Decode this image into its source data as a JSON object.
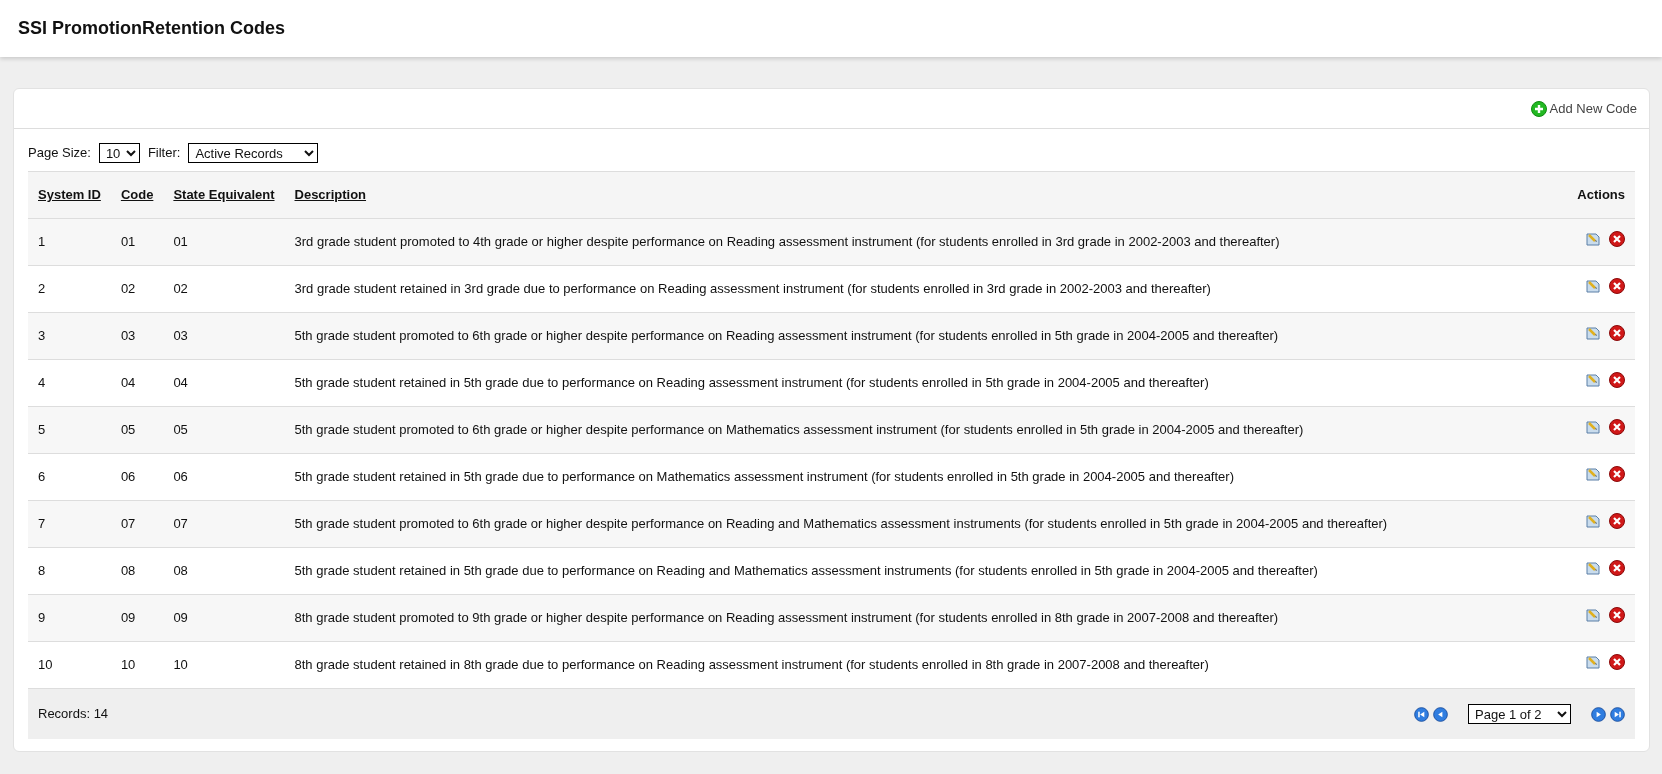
{
  "page_title": "SSI PromotionRetention Codes",
  "add_button": "Add New Code",
  "page_size": {
    "label": "Page Size:",
    "value": "10"
  },
  "filter": {
    "label": "Filter:",
    "value": "Active Records"
  },
  "table": {
    "columns": [
      "System ID",
      "Code",
      "State Equivalent",
      "Description",
      "Actions"
    ],
    "rows": [
      {
        "system_id": "1",
        "code": "01",
        "state_equivalent": "01",
        "description": "3rd grade student promoted to 4th grade or higher despite performance on Reading assessment instrument (for students enrolled in 3rd grade in 2002-2003 and thereafter)"
      },
      {
        "system_id": "2",
        "code": "02",
        "state_equivalent": "02",
        "description": "3rd grade student retained in 3rd grade due to performance on Reading assessment instrument (for students enrolled in 3rd grade in 2002-2003 and thereafter)"
      },
      {
        "system_id": "3",
        "code": "03",
        "state_equivalent": "03",
        "description": "5th grade student promoted to 6th grade or higher despite performance on Reading assessment instrument (for students enrolled in 5th grade in 2004-2005 and thereafter)"
      },
      {
        "system_id": "4",
        "code": "04",
        "state_equivalent": "04",
        "description": "5th grade student retained in 5th grade due to performance on Reading assessment instrument (for students enrolled in 5th grade in 2004-2005 and thereafter)"
      },
      {
        "system_id": "5",
        "code": "05",
        "state_equivalent": "05",
        "description": "5th grade student promoted to 6th grade or higher despite performance on Mathematics assessment instrument (for students enrolled in 5th grade in 2004-2005 and thereafter)"
      },
      {
        "system_id": "6",
        "code": "06",
        "state_equivalent": "06",
        "description": "5th grade student retained in 5th grade due to performance on Mathematics assessment instrument (for students enrolled in 5th grade in 2004-2005 and thereafter)"
      },
      {
        "system_id": "7",
        "code": "07",
        "state_equivalent": "07",
        "description": "5th grade student promoted to 6th grade or higher despite performance on Reading and Mathematics assessment instruments (for students enrolled in 5th grade in 2004-2005 and thereafter)"
      },
      {
        "system_id": "8",
        "code": "08",
        "state_equivalent": "08",
        "description": "5th grade student retained in 5th grade due to performance on Reading and Mathematics assessment instruments (for students enrolled in 5th grade in 2004-2005 and thereafter)"
      },
      {
        "system_id": "9",
        "code": "09",
        "state_equivalent": "09",
        "description": "8th grade student promoted to 9th grade or higher despite performance on Reading assessment instrument (for students enrolled in 8th grade in 2007-2008 and thereafter)"
      },
      {
        "system_id": "10",
        "code": "10",
        "state_equivalent": "10",
        "description": "8th grade student retained in 8th grade due to performance on Reading assessment instrument (for students enrolled in 8th grade in 2007-2008 and thereafter)"
      }
    ]
  },
  "records": "Records: 14",
  "pager": {
    "value": "Page 1 of 2"
  }
}
